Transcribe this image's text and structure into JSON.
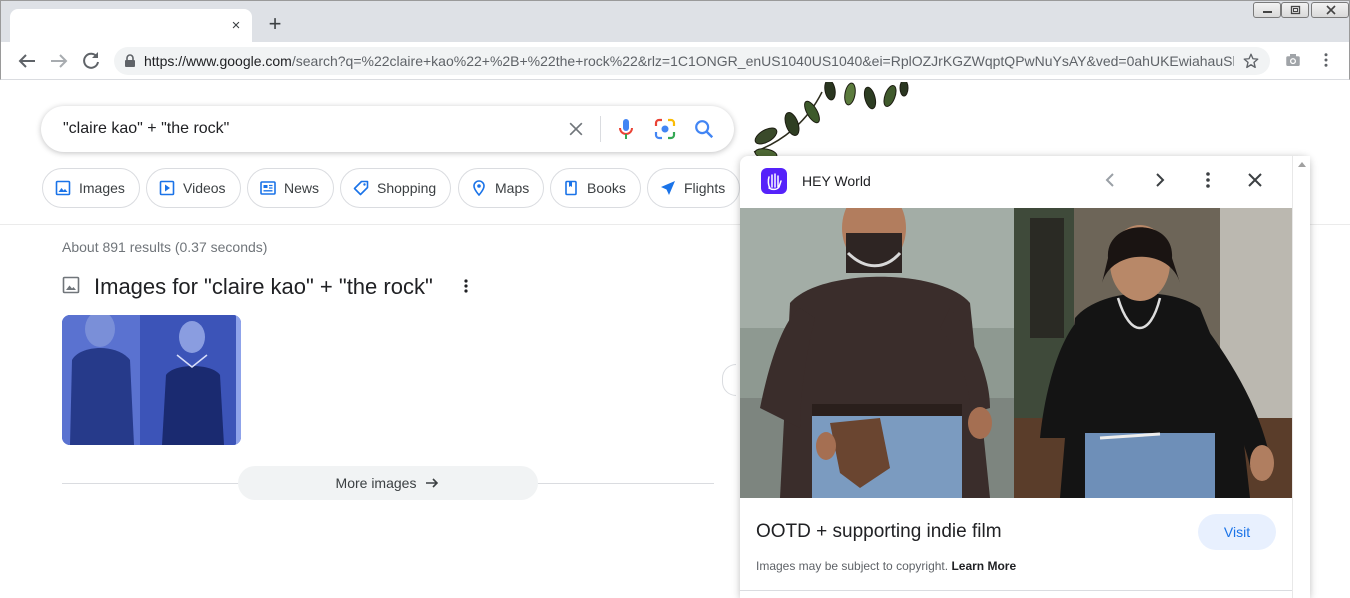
{
  "browser": {
    "tab_title": "",
    "new_tab_symbol": "+",
    "close_symbol": "×",
    "url_host": "https://www.google.com",
    "url_rest": "/search?q=%22claire+kao%22+%2B+%22the+rock%22&rlz=1C1ONGR_enUS1040US1040&ei=RplOZJrKGZWqptQPwNuYsAY&ved=0ahUKEwiahauSh..."
  },
  "search": {
    "query": "\"claire kao\" + \"the rock\""
  },
  "chips": [
    {
      "label": "Images",
      "icon": "image-icon"
    },
    {
      "label": "Videos",
      "icon": "video-icon"
    },
    {
      "label": "News",
      "icon": "news-icon"
    },
    {
      "label": "Shopping",
      "icon": "tag-icon"
    },
    {
      "label": "Maps",
      "icon": "map-pin-icon"
    },
    {
      "label": "Books",
      "icon": "book-icon"
    },
    {
      "label": "Flights",
      "icon": "plane-icon"
    }
  ],
  "results": {
    "stats": "About 891 results (0.37 seconds)",
    "images_heading": "Images for \"claire kao\" + \"the rock\"",
    "more_images": "More images"
  },
  "panel": {
    "site_name": "HEY World",
    "title": "OOTD + supporting indie film",
    "visit_label": "Visit",
    "copyright_text": "Images may be subject to copyright.",
    "learn_more": "Learn More"
  },
  "colors": {
    "google_blue": "#1a73e8",
    "hey_purple": "#5522fa",
    "chip_border": "#dadce0"
  }
}
